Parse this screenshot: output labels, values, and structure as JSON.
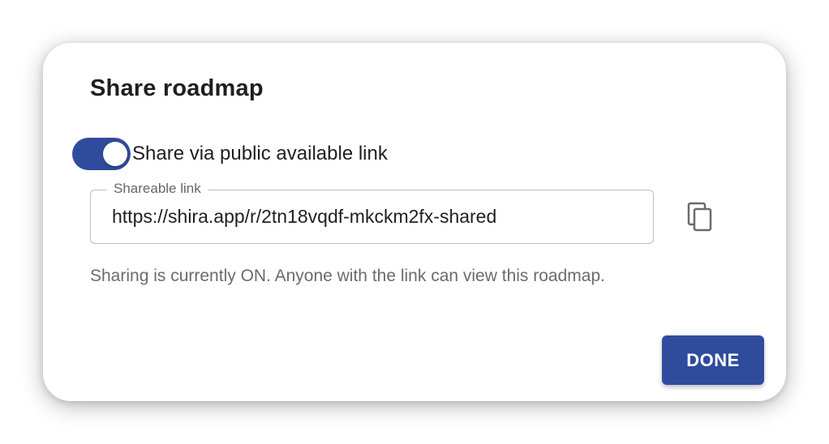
{
  "dialog": {
    "title": "Share roadmap",
    "toggle": {
      "label": "Share via public available link",
      "state": "on",
      "color": "#2f4b9c"
    },
    "link_field": {
      "label": "Shareable link",
      "value": "https://shira.app/r/2tn18vqdf-mkckm2fx-shared"
    },
    "copy_icon": "copy-icon",
    "helper_text": "Sharing is currently ON. Anyone with the link can view this roadmap.",
    "done_label": "DONE",
    "accent_color": "#2f4b9c"
  }
}
